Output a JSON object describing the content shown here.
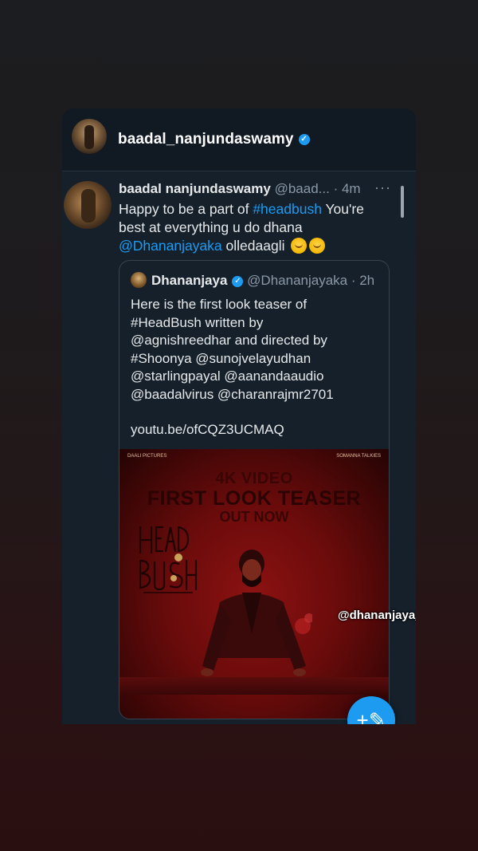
{
  "header": {
    "username": "baadal_nanjundaswamy"
  },
  "tweet": {
    "display_name": "baadal nanjundaswamy",
    "handle": "@baad...",
    "time": "· 4m",
    "text_line1_a": "Happy to be a part of ",
    "hashtag": "#headbush",
    "text_line1_b": " You're",
    "text_line2": "best at everything u do dhana",
    "mention": "@Dhananjayaka",
    "text_line3_b": " olledaagli"
  },
  "quote": {
    "display_name": "Dhananjaya",
    "handle": "@Dhananjayaka · 2h",
    "lines": [
      "Here is the first look teaser of",
      "#HeadBush written by",
      "@agnishreedhar and directed by",
      "#Shoonya @sunojvelayudhan",
      "@starlingpayal @aanandaaudio",
      "@baadalvirus @charanrajmr2701"
    ],
    "url": "youtu.be/ofCQZ3UCMAQ"
  },
  "poster": {
    "top_left": "DAALI PICTURES",
    "top_right": "SOMANNA TALKIES",
    "line1": "4K VIDEO",
    "line2": "FIRST LOOK TEASER",
    "line3": "OUT NOW"
  },
  "sticker": "@dhananjaya_ka",
  "icons": {
    "verified": "verified-badge-icon",
    "more": "more-horizontal-icon",
    "compose": "compose-feather-icon",
    "emoji": "hugging-face-emoji"
  },
  "colors": {
    "link": "#1d9bf0",
    "card_bg": "#15202b",
    "text": "#e7e9ea",
    "muted": "#8b98a5"
  }
}
